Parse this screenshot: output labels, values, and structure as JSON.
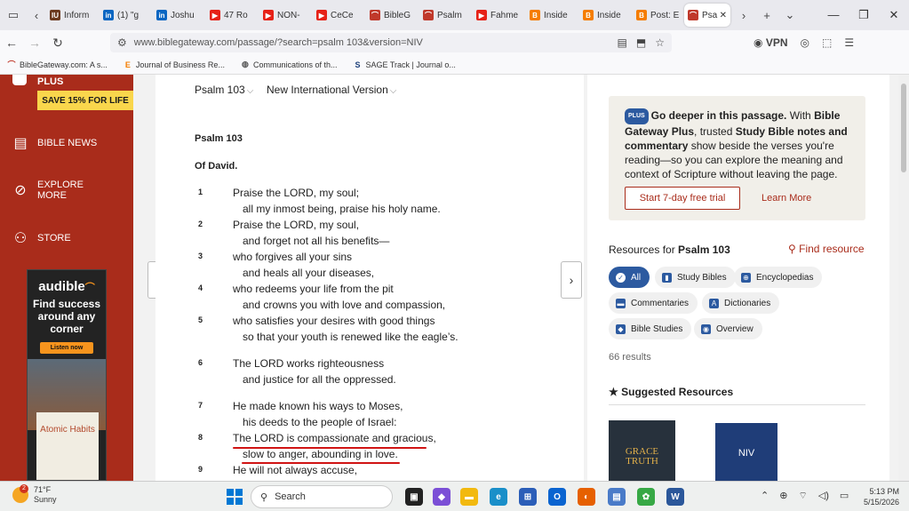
{
  "tabs": [
    {
      "label": "Inform",
      "fav": "IU",
      "color": "#6b3a1f"
    },
    {
      "label": "(1) \"g",
      "fav": "in",
      "color": "#0a66c2"
    },
    {
      "label": "Joshu",
      "fav": "in",
      "color": "#0a66c2"
    },
    {
      "label": "47 Ro",
      "fav": "▶",
      "color": "#e62117"
    },
    {
      "label": "NON-",
      "fav": "▶",
      "color": "#e62117"
    },
    {
      "label": "CeCe",
      "fav": "▶",
      "color": "#e62117"
    },
    {
      "label": "BibleG",
      "fav": "⌒",
      "color": "#c0392b"
    },
    {
      "label": "Psalm",
      "fav": "⌒",
      "color": "#c0392b"
    },
    {
      "label": "Fahme",
      "fav": "▶",
      "color": "#e62117"
    },
    {
      "label": "Inside",
      "fav": "B",
      "color": "#f57d00"
    },
    {
      "label": "Inside",
      "fav": "B",
      "color": "#f57d00"
    },
    {
      "label": "Post: E",
      "fav": "B",
      "color": "#f57d00"
    }
  ],
  "active_tab": {
    "label": "Psa",
    "fav": "⌒",
    "color": "#c0392b"
  },
  "url": "www.biblegateway.com/passage/?search=psalm 103&version=NIV",
  "vpn_label": "VPN",
  "bookmarks": [
    {
      "label": "BibleGateway.com: A s...",
      "fav": "⌒",
      "color": "#c0392b"
    },
    {
      "label": "Journal of Business Re...",
      "fav": "E",
      "color": "#f57d00"
    },
    {
      "label": "Communications of th...",
      "fav": "◍",
      "color": "#555"
    },
    {
      "label": "SAGE Track | Journal o...",
      "fav": "S",
      "color": "#1b3f7a"
    }
  ],
  "sidebar": {
    "plus": "PLUS",
    "save": "SAVE 15% FOR LIFE",
    "items": [
      {
        "label": "BIBLE NEWS",
        "icon": "news-icon"
      },
      {
        "label": "EXPLORE MORE",
        "label2": "MORE",
        "icon": "compass-icon"
      },
      {
        "label": "STORE",
        "icon": "store-icon"
      }
    ],
    "ad": {
      "brand": "audible",
      "headline": "Find success around any corner",
      "button": "Listen now",
      "book_title": "Atomic Habits"
    }
  },
  "passage": {
    "book": "Psalm 103",
    "version": "New International Version",
    "title": "Psalm 103",
    "subtitle": "Of David.",
    "verses": [
      {
        "n": "1",
        "lines": [
          "Praise the LORD, my soul;",
          "all my inmost being, praise his holy name."
        ]
      },
      {
        "n": "2",
        "lines": [
          "Praise the LORD, my soul,",
          "and forget not all his benefits—"
        ]
      },
      {
        "n": "3",
        "lines": [
          "who forgives all your sins",
          "and heals all your diseases,"
        ]
      },
      {
        "n": "4",
        "lines": [
          "who redeems your life from the pit",
          "and crowns you with love and compassion,"
        ]
      },
      {
        "n": "5",
        "lines": [
          "who satisfies your desires with good things",
          "so that your youth is renewed like the eagle’s."
        ]
      },
      {
        "n": "6",
        "lines": [
          "The LORD works righteousness",
          "and justice for all the oppressed."
        ]
      },
      {
        "n": "7",
        "lines": [
          "He made known his ways to Moses,",
          "his deeds to the people of Israel:"
        ]
      },
      {
        "n": "8",
        "lines": [
          "The LORD is compassionate and gracious,",
          "slow to anger, abounding in love."
        ]
      },
      {
        "n": "9",
        "lines": [
          "He will not always accuse,"
        ]
      }
    ]
  },
  "promo": {
    "badge": "PLUS",
    "text_bold1": "Go deeper in this passage.",
    "text1": " With ",
    "text_bold2": "Bible Gateway Plus",
    "text2": ", trusted ",
    "text_bold3": "Study Bible notes and commentary",
    "text3": " show beside the verses you're reading—so you can explore the meaning and context of Scripture without leaving the page.",
    "trial_button": "Start 7-day free trial",
    "learn_more": "Learn More"
  },
  "resources": {
    "heading_prefix": "Resources for ",
    "heading_bold": "Psalm 103",
    "find_label": "Find resource",
    "chips": [
      "All",
      "Study Bibles",
      "Encyclopedias",
      "Commentaries",
      "Dictionaries",
      "Bible Studies",
      "Overview"
    ],
    "results": "66 results",
    "suggested": "Suggested Resources",
    "book1": "GRACE TRUTH",
    "book2": "NIV"
  },
  "taskbar": {
    "temp": "71°F",
    "weather": "Sunny",
    "badge": "2",
    "search": "Search",
    "time": "5:13 PM",
    "date": "5/15/2026"
  }
}
